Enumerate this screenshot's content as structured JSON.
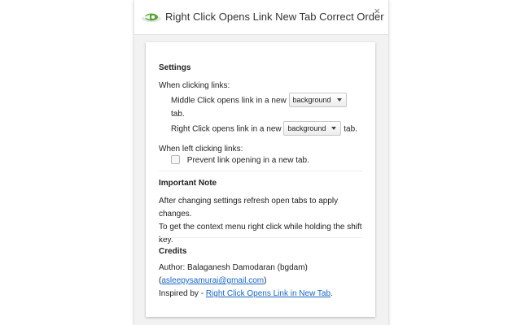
{
  "window": {
    "title": "Right Click Opens Link New Tab Correct Order",
    "close_glyph": "×"
  },
  "settings": {
    "heading": "Settings",
    "when_clicking_label": "When clicking links:",
    "middle_click_prefix": "Middle Click opens link in a new",
    "middle_click_value": "background",
    "middle_click_suffix": "tab.",
    "right_click_prefix": "Right Click opens link in a new",
    "right_click_value": "background",
    "right_click_suffix": "tab.",
    "when_left_clicking_label": "When left clicking links:",
    "prevent_label": "Prevent link opening in a new tab.",
    "prevent_checked": false
  },
  "note": {
    "heading": "Important Note",
    "line1": "After changing settings refresh open tabs to apply changes.",
    "line2": "To get the context menu right click while holding the shift",
    "line3": "key."
  },
  "credits": {
    "heading": "Credits",
    "author_text": "Author: Balaganesh Damodaran (bgdam)",
    "email_open": "(",
    "email": "asleepysamurai@gmail.com",
    "email_close": ")",
    "inspired_prefix": "Inspired by - ",
    "inspired_link": "Right Click Opens Link in New Tab",
    "inspired_suffix": "."
  },
  "icons": {
    "app": "green-arrow-cursor-icon",
    "select_caret": "caret-down-icon",
    "close": "close-icon"
  },
  "colors": {
    "link": "#1a66c7",
    "icon_green": "#5aa637"
  }
}
